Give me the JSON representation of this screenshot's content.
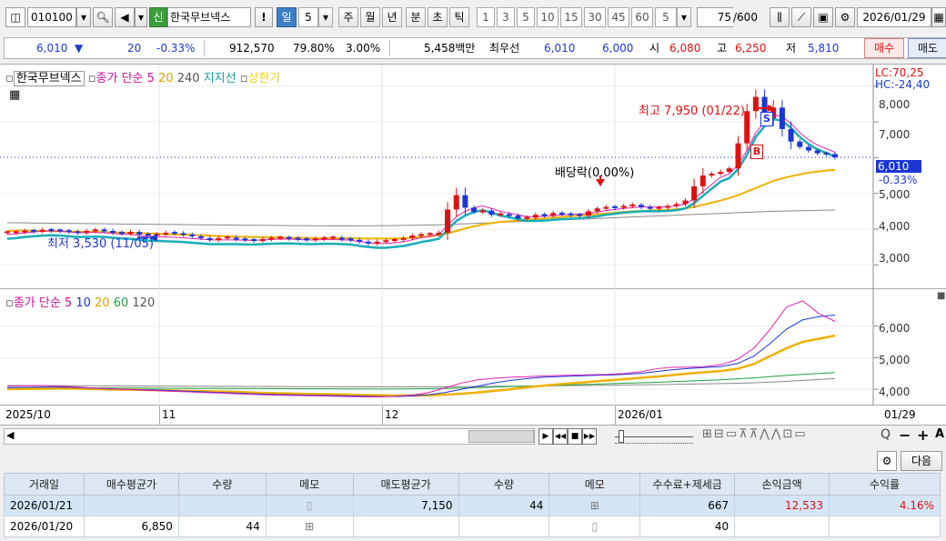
{
  "toolbar": {
    "code": "010100",
    "badge": "신",
    "name": "한국무브넥스",
    "excl": "!",
    "periods": [
      "일",
      "5",
      "주",
      "월",
      "년",
      "분",
      "초",
      "틱"
    ],
    "minutes": [
      "1",
      "3",
      "5",
      "10",
      "15",
      "30",
      "45",
      "60",
      "5"
    ],
    "count": "75",
    "count_total": "/600",
    "date": "2026/01/29"
  },
  "quote": {
    "price": "6,010",
    "arrow": "▼",
    "change": "20",
    "pct": "-0.33%",
    "volume": "912,570",
    "ratio": "79.80%",
    "turn": "3.00%",
    "amount": "5,458백만",
    "pref_label": "최우선",
    "bid1": "6,010",
    "bid2": "6,000",
    "open_label": "시",
    "open": "6,080",
    "high_label": "고",
    "high": "6,250",
    "low_label": "저",
    "low": "5,810",
    "buy": "매수",
    "sell": "매도"
  },
  "price_panel": {
    "legend_name": "한국무브넥스",
    "legend_ma": "종가 단순 5",
    "legend_20": "20",
    "legend_240": "240",
    "legend_support": "지지선",
    "legend_upper": "상한가",
    "lc": "LC:70,25",
    "hc": "HC:-24,40",
    "yticks": [
      "8,000",
      "7,000",
      "6,000",
      "5,000",
      "4,000",
      "3,000"
    ],
    "cur_price": "6,010",
    "cur_pct": "-0.33%",
    "ann_high": "최고 7,950 (01/22)",
    "ann_low": "최저 3,530 (11/05)",
    "ann_div": "배당락(0.00%)",
    "mark_s": "S",
    "mark_b": "B"
  },
  "ma_panel": {
    "legend_ma": "종가 단순 5",
    "legend_10": "10",
    "legend_20": "20",
    "legend_60": "60",
    "legend_120": "120",
    "yticks": [
      "6,000",
      "5,000",
      "4,000"
    ]
  },
  "xaxis": {
    "labels": [
      "2025/10",
      "11",
      "12",
      "2026/01",
      "01/29"
    ]
  },
  "chart_data": {
    "type": "candlestick",
    "x_range": [
      "2025/10",
      "2026/01/29"
    ],
    "price_ylim": [
      2500,
      8400
    ],
    "annotations": {
      "high": 7950,
      "high_date": "01/22",
      "low": 3530,
      "low_date": "11/05",
      "last": 6010,
      "last_pct": -0.33
    },
    "candles_close": [
      3900,
      3920,
      3950,
      3940,
      3980,
      3960,
      3950,
      3930,
      3900,
      3950,
      3980,
      3950,
      3900,
      3880,
      3920,
      3850,
      3830,
      3860,
      3900,
      3880,
      3850,
      3800,
      3750,
      3700,
      3750,
      3760,
      3720,
      3700,
      3680,
      3720,
      3750,
      3760,
      3740,
      3720,
      3700,
      3730,
      3750,
      3760,
      3720,
      3700,
      3650,
      3600,
      3650,
      3680,
      3700,
      3750,
      3820,
      3850,
      3860,
      3900,
      4550,
      4950,
      4600,
      4480,
      4520,
      4400,
      4420,
      4380,
      4300,
      4320,
      4400,
      4380,
      4450,
      4420,
      4400,
      4380,
      4500,
      4580,
      4620,
      4600,
      4650,
      4680,
      4620,
      4580,
      4600,
      4650,
      4700,
      4800,
      5200,
      5500,
      5550,
      5600,
      5700,
      6400,
      7300,
      7700,
      7100,
      7400,
      6800,
      6450,
      6300,
      6200,
      6120,
      6100,
      6010
    ],
    "ma5": [
      3850,
      3870,
      3900,
      3920,
      3940,
      3950,
      3940,
      3920,
      3900,
      3900,
      3910,
      3900,
      3880,
      3860,
      3850,
      3820,
      3800,
      3790,
      3780,
      3770,
      3760,
      3740,
      3720,
      3700,
      3700,
      3700,
      3700,
      3690,
      3690,
      3700,
      3710,
      3720,
      3720,
      3710,
      3700,
      3700,
      3710,
      3710,
      3700,
      3690,
      3650,
      3620,
      3600,
      3600,
      3620,
      3650,
      3700,
      3760,
      3800,
      3850,
      4100,
      4350,
      4500,
      4600,
      4650,
      4580,
      4500,
      4450,
      4400,
      4350,
      4350,
      4360,
      4380,
      4400,
      4410,
      4420,
      4450,
      4480,
      4520,
      4550,
      4580,
      4600,
      4620,
      4620,
      4620,
      4630,
      4650,
      4700,
      4850,
      5050,
      5250,
      5450,
      5550,
      5800,
      6200,
      6700,
      7000,
      7200,
      7150,
      6950,
      6700,
      6500,
      6350,
      6250,
      6150
    ],
    "ma20": [
      3950,
      3960,
      3960,
      3955,
      3950,
      3945,
      3940,
      3935,
      3930,
      3925,
      3920,
      3915,
      3910,
      3905,
      3900,
      3890,
      3880,
      3870,
      3860,
      3850,
      3845,
      3840,
      3830,
      3820,
      3810,
      3800,
      3790,
      3785,
      3780,
      3775,
      3770,
      3765,
      3760,
      3760,
      3755,
      3750,
      3750,
      3748,
      3745,
      3742,
      3740,
      3738,
      3736,
      3735,
      3738,
      3745,
      3760,
      3780,
      3800,
      3830,
      3880,
      3950,
      4020,
      4080,
      4130,
      4170,
      4200,
      4220,
      4240,
      4260,
      4280,
      4300,
      4320,
      4340,
      4360,
      4380,
      4400,
      4420,
      4440,
      4460,
      4480,
      4500,
      4510,
      4520,
      4530,
      4540,
      4560,
      4580,
      4620,
      4680,
      4740,
      4800,
      4870,
      4950,
      5050,
      5150,
      5250,
      5350,
      5420,
      5480,
      5530,
      5580,
      5610,
      5640,
      5660
    ],
    "ma240": [
      4180,
      4180,
      4175,
      4170,
      4168,
      4165,
      4162,
      4160,
      4158,
      4155,
      4152,
      4150,
      4148,
      4145,
      4142,
      4140,
      4138,
      4135,
      4132,
      4130,
      4128,
      4125,
      4122,
      4120,
      4118,
      4115,
      4112,
      4110,
      4108,
      4106,
      4104,
      4102,
      4100,
      4098,
      4096,
      4094,
      4092,
      4090,
      4090,
      4090,
      4092,
      4094,
      4096,
      4098,
      4100,
      4104,
      4108,
      4112,
      4116,
      4120,
      4130,
      4140,
      4150,
      4160,
      4170,
      4180,
      4190,
      4200,
      4210,
      4220,
      4230,
      4240,
      4250,
      4260,
      4270,
      4280,
      4290,
      4300,
      4310,
      4320,
      4330,
      4340,
      4350,
      4360,
      4370,
      4380,
      4390,
      4400,
      4410,
      4420,
      4430,
      4440,
      4450,
      4460,
      4470,
      4480,
      4490,
      4500,
      4505,
      4510,
      4515,
      4520,
      4525,
      4530,
      4535
    ],
    "ma_panel": {
      "ylim": [
        3600,
        7000
      ],
      "series": [
        {
          "name": "5",
          "values": [
            4100,
            4110,
            4120,
            4100,
            4080,
            4050,
            4020,
            4000,
            3980,
            3960,
            3940,
            3920,
            3900,
            3880,
            3860,
            3840,
            3820,
            3810,
            3800,
            3790,
            3780,
            3770,
            3760,
            3760,
            3780,
            3820,
            3900,
            4050,
            4200,
            4300,
            4350,
            4380,
            4400,
            4420,
            4440,
            4450,
            4460,
            4470,
            4500,
            4550,
            4650,
            4700,
            4700,
            4720,
            4780,
            4950,
            5300,
            5900,
            6600,
            6800,
            6400,
            6150
          ]
        },
        {
          "name": "10",
          "values": [
            4050,
            4060,
            4070,
            4070,
            4060,
            4040,
            4020,
            4000,
            3990,
            3980,
            3960,
            3940,
            3920,
            3900,
            3880,
            3860,
            3840,
            3830,
            3820,
            3810,
            3800,
            3790,
            3780,
            3770,
            3770,
            3790,
            3830,
            3900,
            4000,
            4100,
            4200,
            4280,
            4340,
            4380,
            4400,
            4420,
            4440,
            4450,
            4470,
            4500,
            4560,
            4620,
            4660,
            4690,
            4720,
            4820,
            5050,
            5450,
            5900,
            6200,
            6300,
            6350
          ]
        },
        {
          "name": "20",
          "values": [
            4000,
            4010,
            4015,
            4020,
            4020,
            4010,
            4000,
            3990,
            3980,
            3970,
            3960,
            3950,
            3940,
            3930,
            3920,
            3900,
            3880,
            3870,
            3860,
            3850,
            3840,
            3830,
            3820,
            3810,
            3800,
            3800,
            3810,
            3830,
            3860,
            3900,
            3950,
            4000,
            4060,
            4110,
            4160,
            4200,
            4240,
            4280,
            4320,
            4360,
            4400,
            4450,
            4500,
            4540,
            4580,
            4650,
            4800,
            5050,
            5300,
            5500,
            5600,
            5700
          ]
        },
        {
          "name": "60",
          "values": [
            4050,
            4050,
            4050,
            4048,
            4046,
            4044,
            4042,
            4040,
            4038,
            4036,
            4034,
            4032,
            4030,
            4028,
            4026,
            4024,
            4022,
            4020,
            4018,
            4016,
            4014,
            4012,
            4010,
            4008,
            4010,
            4014,
            4020,
            4028,
            4040,
            4055,
            4070,
            4085,
            4100,
            4115,
            4130,
            4145,
            4160,
            4175,
            4190,
            4205,
            4220,
            4240,
            4260,
            4280,
            4300,
            4330,
            4360,
            4400,
            4440,
            4470,
            4500,
            4530
          ]
        },
        {
          "name": "120",
          "values": [
            4120,
            4118,
            4116,
            4114,
            4112,
            4110,
            4108,
            4106,
            4104,
            4102,
            4100,
            4098,
            4096,
            4094,
            4092,
            4090,
            4088,
            4086,
            4084,
            4082,
            4080,
            4078,
            4076,
            4074,
            4074,
            4076,
            4078,
            4080,
            4084,
            4088,
            4092,
            4096,
            4100,
            4106,
            4112,
            4118,
            4124,
            4130,
            4136,
            4142,
            4148,
            4156,
            4164,
            4172,
            4180,
            4190,
            4205,
            4225,
            4250,
            4280,
            4310,
            4340
          ]
        }
      ]
    }
  },
  "scroll": {
    "left": "◀",
    "ctrl": [
      "▶",
      "◀◀",
      "■",
      "▶▶"
    ]
  },
  "tools": {
    "icons": [
      "⊞",
      "⊟",
      "▭",
      "⊼",
      "⊼",
      "⋀",
      "⋀",
      "⊡",
      "▭"
    ],
    "zoom": "Q",
    "minus": "−",
    "plus": "+",
    "a": "A"
  },
  "table": {
    "next": "다음",
    "headers": [
      "거래일",
      "매수평균가",
      "수량",
      "메모",
      "매도평균가",
      "수량",
      "메모",
      "수수료+제세금",
      "손익금액",
      "수익률"
    ],
    "rows": [
      [
        "2026/01/21",
        "",
        "",
        "",
        "7,150",
        "44",
        "",
        "667",
        "12,533",
        "4.16%"
      ],
      [
        "2026/01/20",
        "6,850",
        "44",
        "",
        "",
        "",
        "",
        "40",
        "",
        ""
      ]
    ]
  }
}
